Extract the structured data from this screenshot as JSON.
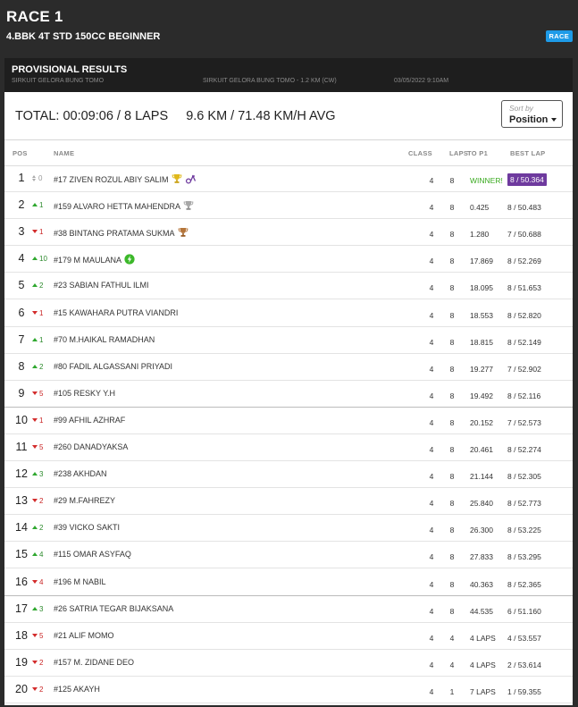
{
  "header": {
    "title": "RACE 1",
    "subtitle": "4.BBK 4T STD 150CC BEGINNER",
    "badge": "RACE"
  },
  "provisional": {
    "title": "PROVISIONAL RESULTS",
    "circuit": "SIRKUIT GELORA BUNG TOMO",
    "circuit_detail": "SIRKUIT GELORA BUNG TOMO - 1.2 KM (CW)",
    "datetime": "03/05/2022 9:10AM"
  },
  "summary": {
    "total": "TOTAL: 00:09:06 / 8 LAPS",
    "distance": "9.6 KM / 71.48 KM/H AVG"
  },
  "sort": {
    "label": "Sort by",
    "value": "Position"
  },
  "columns": {
    "pos": "POS",
    "name": "NAME",
    "class": "CLASS",
    "laps": "LAPS",
    "gap": "TO P1",
    "best": "BEST LAP"
  },
  "colors": {
    "up": "#2fa82f",
    "down": "#d32c2c",
    "winner": "#3aaa20",
    "fastest_lap_bg": "#6e3a9e",
    "race_badge": "#1e9be8"
  },
  "rows": [
    {
      "pos": "1",
      "dir": "same",
      "chg": "0",
      "name": "#17 ZIVEN ROZUL ABIY SALIM",
      "icons": [
        "gold-trophy-icon",
        "fastest-lap-icon"
      ],
      "cls": "4",
      "laps": "8",
      "gap": "WINNER!",
      "best": "8 / 50.364",
      "fastest": true
    },
    {
      "pos": "2",
      "dir": "up",
      "chg": "1",
      "name": "#159 ALVARO HETTA MAHENDRA",
      "icons": [
        "silver-trophy-icon"
      ],
      "cls": "4",
      "laps": "8",
      "gap": "0.425",
      "best": "8 / 50.483"
    },
    {
      "pos": "3",
      "dir": "down",
      "chg": "1",
      "name": "#38 BINTANG PRATAMA SUKMA",
      "icons": [
        "bronze-trophy-icon"
      ],
      "cls": "4",
      "laps": "8",
      "gap": "1.280",
      "best": "7 / 50.688"
    },
    {
      "pos": "4",
      "dir": "up",
      "chg": "10",
      "name": "#179 M MAULANA",
      "icons": [
        "lightning-icon"
      ],
      "cls": "4",
      "laps": "8",
      "gap": "17.869",
      "best": "8 / 52.269"
    },
    {
      "pos": "5",
      "dir": "up",
      "chg": "2",
      "name": "#23 SABIAN FATHUL ILMI",
      "icons": [],
      "cls": "4",
      "laps": "8",
      "gap": "18.095",
      "best": "8 / 51.653"
    },
    {
      "pos": "6",
      "dir": "down",
      "chg": "1",
      "name": "#15 KAWAHARA PUTRA VIANDRI",
      "icons": [],
      "cls": "4",
      "laps": "8",
      "gap": "18.553",
      "best": "8 / 52.820"
    },
    {
      "pos": "7",
      "dir": "up",
      "chg": "1",
      "name": "#70 M.HAIKAL RAMADHAN",
      "icons": [],
      "cls": "4",
      "laps": "8",
      "gap": "18.815",
      "best": "8 / 52.149"
    },
    {
      "pos": "8",
      "dir": "up",
      "chg": "2",
      "name": "#80 FADIL ALGASSANI PRIYADI",
      "icons": [],
      "cls": "4",
      "laps": "8",
      "gap": "19.277",
      "best": "7 / 52.902"
    },
    {
      "pos": "9",
      "dir": "down",
      "chg": "5",
      "name": "#105 RESKY Y.H",
      "icons": [],
      "cls": "4",
      "laps": "8",
      "gap": "19.492",
      "best": "8 / 52.116"
    },
    {
      "pos": "10",
      "dir": "down",
      "chg": "1",
      "name": "#99 AFHIL AZHRAF",
      "icons": [],
      "cls": "4",
      "laps": "8",
      "gap": "20.152",
      "best": "7 / 52.573"
    },
    {
      "pos": "11",
      "dir": "down",
      "chg": "5",
      "name": "#260 DANADYAKSA",
      "icons": [],
      "cls": "4",
      "laps": "8",
      "gap": "20.461",
      "best": "8 / 52.274"
    },
    {
      "pos": "12",
      "dir": "up",
      "chg": "3",
      "name": "#238 AKHDAN",
      "icons": [],
      "cls": "4",
      "laps": "8",
      "gap": "21.144",
      "best": "8 / 52.305"
    },
    {
      "pos": "13",
      "dir": "down",
      "chg": "2",
      "name": "#29 M.FAHREZY",
      "icons": [],
      "cls": "4",
      "laps": "8",
      "gap": "25.840",
      "best": "8 / 52.773"
    },
    {
      "pos": "14",
      "dir": "up",
      "chg": "2",
      "name": "#39 VICKO SAKTI",
      "icons": [],
      "cls": "4",
      "laps": "8",
      "gap": "26.300",
      "best": "8 / 53.225"
    },
    {
      "pos": "15",
      "dir": "up",
      "chg": "4",
      "name": "#115 OMAR ASYFAQ",
      "icons": [],
      "cls": "4",
      "laps": "8",
      "gap": "27.833",
      "best": "8 / 53.295"
    },
    {
      "pos": "16",
      "dir": "down",
      "chg": "4",
      "name": "#196 M NABIL",
      "icons": [],
      "cls": "4",
      "laps": "8",
      "gap": "40.363",
      "best": "8 / 52.365"
    },
    {
      "pos": "17",
      "dir": "up",
      "chg": "3",
      "name": "#26 SATRIA TEGAR BIJAKSANA",
      "icons": [],
      "cls": "4",
      "laps": "8",
      "gap": "44.535",
      "best": "6 / 51.160"
    },
    {
      "pos": "18",
      "dir": "down",
      "chg": "5",
      "name": "#21 ALIF MOMO",
      "icons": [],
      "cls": "4",
      "laps": "4",
      "gap": "4 LAPS",
      "best": "4 / 53.557"
    },
    {
      "pos": "19",
      "dir": "down",
      "chg": "2",
      "name": "#157 M. ZIDANE DEO",
      "icons": [],
      "cls": "4",
      "laps": "4",
      "gap": "4 LAPS",
      "best": "2 / 53.614"
    },
    {
      "pos": "20",
      "dir": "down",
      "chg": "2",
      "name": "#125 AKAYH",
      "icons": [],
      "cls": "4",
      "laps": "1",
      "gap": "7 LAPS",
      "best": "1 / 59.355"
    }
  ]
}
